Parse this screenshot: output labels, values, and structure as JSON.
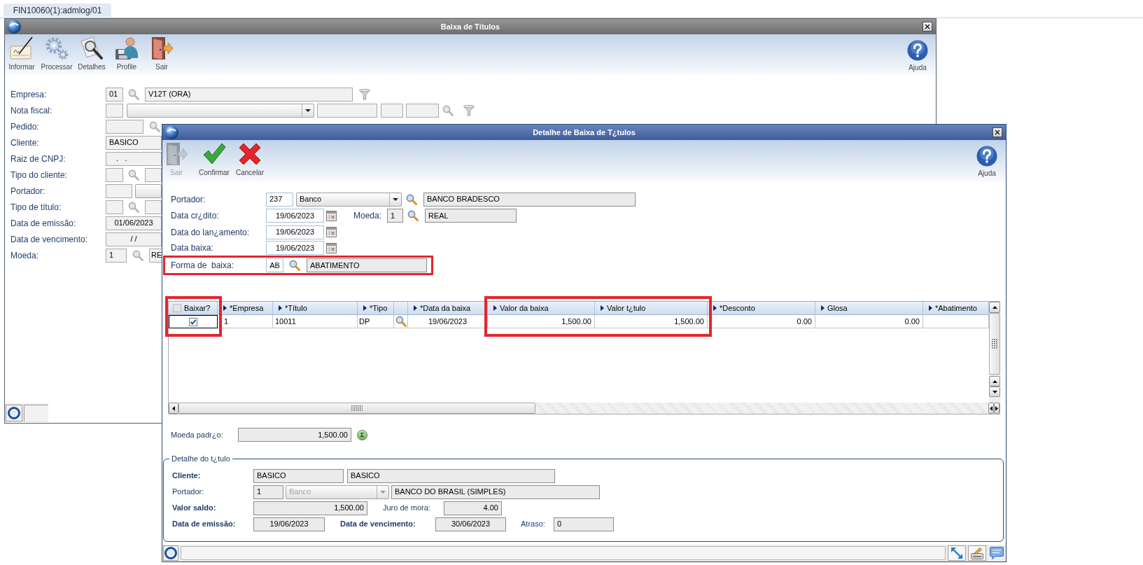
{
  "tabs": [
    {
      "label": "FIN10060(1):admlog/01",
      "selected": true
    }
  ],
  "main_window": {
    "title": "Baixa de Títulos",
    "toolbar": [
      {
        "label": "Informar",
        "kind": "inform"
      },
      {
        "label": "Processar",
        "kind": "process"
      },
      {
        "label": "Detalhes",
        "kind": "details"
      },
      {
        "label": "Profile",
        "kind": "profile"
      },
      {
        "label": "Sair",
        "kind": "exit"
      }
    ],
    "help": {
      "label": "Ajuda"
    },
    "form": [
      {
        "label": "Empresa:",
        "controls": [
          {
            "kind": "field",
            "value": "01"
          },
          {
            "kind": "lookup"
          },
          {
            "kind": "field",
            "value": "V12T (ORA)"
          },
          {
            "kind": "filter"
          }
        ]
      },
      {
        "label": "Nota fiscal:",
        "controls": [
          {
            "kind": "field"
          },
          {
            "kind": "combo"
          },
          {
            "kind": "field"
          },
          {
            "kind": "field"
          },
          {
            "kind": "field"
          },
          {
            "kind": "lookup"
          },
          {
            "kind": "filter"
          }
        ]
      },
      {
        "label": "Pedido:",
        "controls": [
          {
            "kind": "field"
          },
          {
            "kind": "lookup"
          }
        ]
      },
      {
        "label": "Cliente:",
        "controls": [
          {
            "kind": "field",
            "value": "BASICO"
          }
        ]
      },
      {
        "label": "Raiz de CNPJ:",
        "controls": [
          {
            "kind": "field",
            "value": ".   ."
          }
        ]
      },
      {
        "label": "Tipo do cliente:",
        "controls": [
          {
            "kind": "field"
          },
          {
            "kind": "lookup"
          },
          {
            "kind": "field"
          }
        ]
      },
      {
        "label": "Portador:",
        "controls": [
          {
            "kind": "field"
          },
          {
            "kind": "combo"
          }
        ]
      },
      {
        "label": "Tipo de título:",
        "controls": [
          {
            "kind": "field"
          },
          {
            "kind": "lookup"
          },
          {
            "kind": "field"
          }
        ]
      },
      {
        "label": "Data de emissão:",
        "controls": [
          {
            "kind": "field",
            "value": "01/06/2023"
          }
        ]
      },
      {
        "label": "Data de vencimento:",
        "controls": [
          {
            "kind": "field",
            "value": "/ /"
          }
        ]
      },
      {
        "label": "Moeda:",
        "controls": [
          {
            "kind": "field",
            "value": "1"
          },
          {
            "kind": "lookup"
          },
          {
            "kind": "field",
            "value": "RE"
          }
        ]
      }
    ]
  },
  "detail_window": {
    "title": "Detalhe de Baixa de T¿tulos",
    "toolbar": [
      {
        "label": "Sair",
        "kind": "exit",
        "disabled": true
      },
      {
        "label": "Confirmar",
        "kind": "confirm",
        "disabled": false
      },
      {
        "label": "Cancelar",
        "kind": "cancel",
        "disabled": false
      }
    ],
    "help": {
      "label": "Ajuda"
    },
    "form": [
      {
        "label": "Portador:",
        "highlighted": false,
        "controls": [
          {
            "kind": "input",
            "value": "237"
          },
          {
            "kind": "combo",
            "value": "Banco",
            "disabled": false
          },
          {
            "kind": "lookup"
          },
          {
            "kind": "readonly",
            "value": "BANCO BRADESCO"
          }
        ]
      },
      {
        "label": "Data cr¿dito:",
        "highlighted": false,
        "controls": [
          {
            "kind": "date",
            "value": "19/06/2023"
          },
          {
            "kind": "calendar"
          },
          {
            "kind": "label",
            "text": "Moeda:"
          },
          {
            "kind": "readonly",
            "value": "1"
          },
          {
            "kind": "lookup"
          },
          {
            "kind": "readonly",
            "value": "REAL"
          }
        ]
      },
      {
        "label": "Data do lan¿amento:",
        "highlighted": false,
        "controls": [
          {
            "kind": "date",
            "value": "19/06/2023"
          },
          {
            "kind": "calendar"
          }
        ]
      },
      {
        "label": "Data baixa:",
        "highlighted": false,
        "controls": [
          {
            "kind": "date",
            "value": "19/06/2023"
          },
          {
            "kind": "calendar"
          }
        ]
      },
      {
        "label": "Forma de  baixa:",
        "highlighted": true,
        "controls": [
          {
            "kind": "input",
            "value": "AB"
          },
          {
            "kind": "lookup"
          },
          {
            "kind": "readonly",
            "value": "ABATIMENTO"
          }
        ]
      }
    ],
    "table": {
      "columns": [
        {
          "kind": "checkbox",
          "label": "Baixar?",
          "checked": false,
          "highlighted": true
        },
        {
          "kind": "text",
          "label": "*Empresa",
          "highlighted": false
        },
        {
          "kind": "text",
          "label": "*Título",
          "highlighted": false
        },
        {
          "kind": "text",
          "label": "*Tipo",
          "highlighted": false
        },
        {
          "kind": "blank",
          "highlighted": false
        },
        {
          "kind": "text",
          "label": "*Data da baixa",
          "highlighted": false
        },
        {
          "kind": "text",
          "label": "Valor da baixa",
          "highlighted": true
        },
        {
          "kind": "text",
          "label": "Valor t¿tulo",
          "highlighted": true
        },
        {
          "kind": "text",
          "label": "*Desconto",
          "highlighted": false
        },
        {
          "kind": "text",
          "label": "Glosa",
          "highlighted": false
        },
        {
          "kind": "text",
          "label": "*Abatimento",
          "highlighted": false
        }
      ],
      "rows": [
        {
          "cells": [
            {
              "kind": "checkbox",
              "checked": true,
              "focused": true
            },
            {
              "kind": "text",
              "text": "1",
              "focused": false
            },
            {
              "kind": "text",
              "text": "10011",
              "focused": false
            },
            {
              "kind": "text",
              "text": "DP",
              "focused": false
            },
            {
              "kind": "lookup",
              "focused": false
            },
            {
              "kind": "text",
              "text": "19/06/2023",
              "focused": false
            },
            {
              "kind": "text",
              "text": "1,500.00",
              "focused": false
            },
            {
              "kind": "text",
              "text": "1,500.00",
              "focused": false
            },
            {
              "kind": "text",
              "text": "0.00",
              "focused": false
            },
            {
              "kind": "text",
              "text": "0.00",
              "focused": false
            }
          ]
        }
      ]
    },
    "moeda_padrao": {
      "label": "Moeda padr¿o:",
      "value": "1,500.00",
      "action": "Σ"
    },
    "detail_group": {
      "legend": "Detalhe do t¿tulo",
      "rows": [
        {
          "controls": [
            {
              "kind": "label",
              "text": "Cliente:"
            },
            {
              "kind": "readonly",
              "value": "BASICO"
            },
            {
              "kind": "readonly",
              "value": "BASICO"
            }
          ]
        },
        {
          "controls": [
            {
              "kind": "label",
              "text": "Portador:"
            },
            {
              "kind": "readonly",
              "value": "1"
            },
            {
              "kind": "combo",
              "value": "Banco",
              "disabled": true
            },
            {
              "kind": "readonly",
              "value": "BANCO DO BRASIL (SIMPLES)"
            }
          ]
        },
        {
          "controls": [
            {
              "kind": "label",
              "text": "Valor saldo:"
            },
            {
              "kind": "readonly",
              "value": "1,500.00"
            },
            {
              "kind": "label",
              "text": "Juro de mora:"
            },
            {
              "kind": "readonly",
              "value": "4.00"
            }
          ]
        },
        {
          "controls": [
            {
              "kind": "label",
              "text": "Data de emissão:"
            },
            {
              "kind": "readonly",
              "value": "19/06/2023"
            },
            {
              "kind": "label",
              "text": "Data de vencimento:"
            },
            {
              "kind": "readonly",
              "value": "30/06/2023"
            },
            {
              "kind": "label",
              "text": "Atraso:"
            },
            {
              "kind": "readonly",
              "value": "0"
            }
          ]
        }
      ]
    }
  }
}
